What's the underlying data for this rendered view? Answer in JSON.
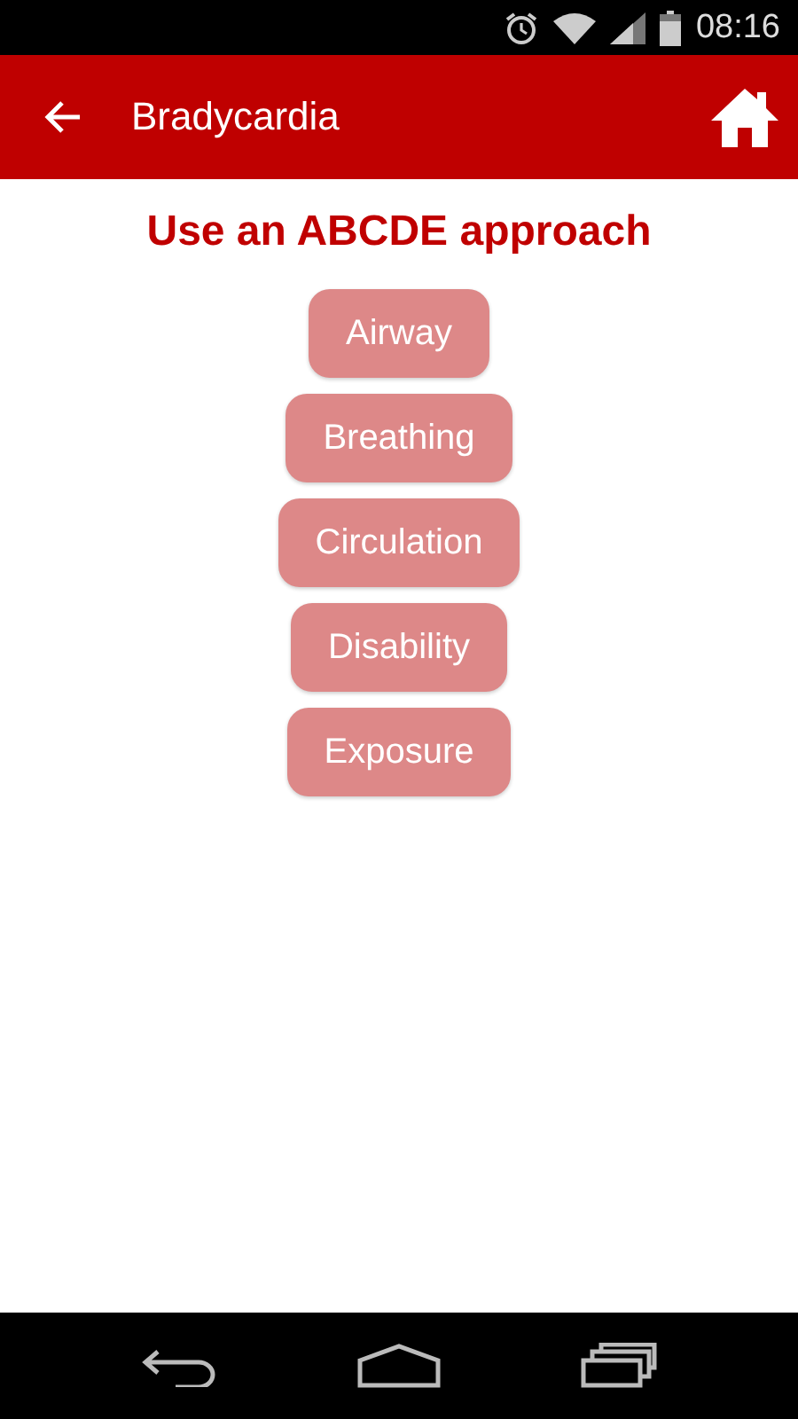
{
  "status_bar": {
    "time": "08:16"
  },
  "app_bar": {
    "title": "Bradycardia"
  },
  "heading": "Use an ABCDE approach",
  "buttons": [
    "Airway",
    "Breathing",
    "Circulation",
    "Disability",
    "Exposure"
  ]
}
